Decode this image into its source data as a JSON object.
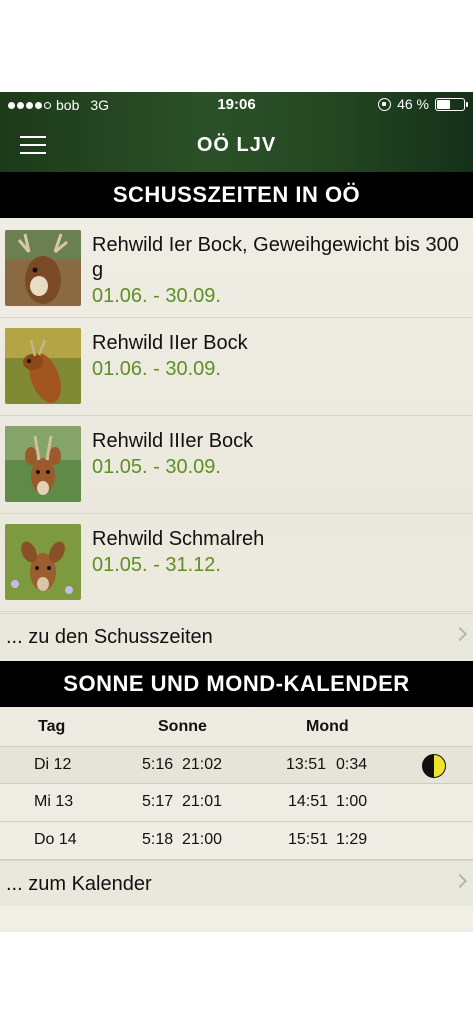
{
  "status": {
    "carrier": "bob",
    "network": "3G",
    "time": "19:06",
    "battery": "46 %"
  },
  "nav": {
    "title": "OÖ LJV",
    "menu_icon": "hamburger-menu-icon"
  },
  "hunting": {
    "header": "SCHUSSZEITEN IN OÖ",
    "items": [
      {
        "title": "Rehwild Ier Bock, Geweihgewicht bis 300 g",
        "dates": "01.06. - 30.09."
      },
      {
        "title": "Rehwild IIer Bock",
        "dates": "01.06. - 30.09."
      },
      {
        "title": "Rehwild IIIer Bock",
        "dates": "01.05. - 30.09."
      },
      {
        "title": "Rehwild Schmalreh",
        "dates": "01.05. - 31.12."
      }
    ],
    "link": "... zu den Schusszeiten"
  },
  "calendar": {
    "header": "SONNE UND MOND-KALENDER",
    "columns": {
      "day": "Tag",
      "sun": "Sonne",
      "moon": "Mond"
    },
    "rows": [
      {
        "day": "Di 12",
        "sunrise": "5:16",
        "sunset": "21:02",
        "moonrise": "13:51",
        "moonset": "0:34",
        "phase_icon": "half-moon-icon"
      },
      {
        "day": "Mi 13",
        "sunrise": "5:17",
        "sunset": "21:01",
        "moonrise": "14:51",
        "moonset": "1:00"
      },
      {
        "day": "Do 14",
        "sunrise": "5:18",
        "sunset": "21:00",
        "moonrise": "15:51",
        "moonset": "1:29"
      }
    ],
    "link": "... zum Kalender"
  },
  "colors": {
    "topbar": "#2c5128",
    "accent_green": "#5e8f23",
    "header_bg": "#000000",
    "moon_yellow": "#f1e22c"
  }
}
